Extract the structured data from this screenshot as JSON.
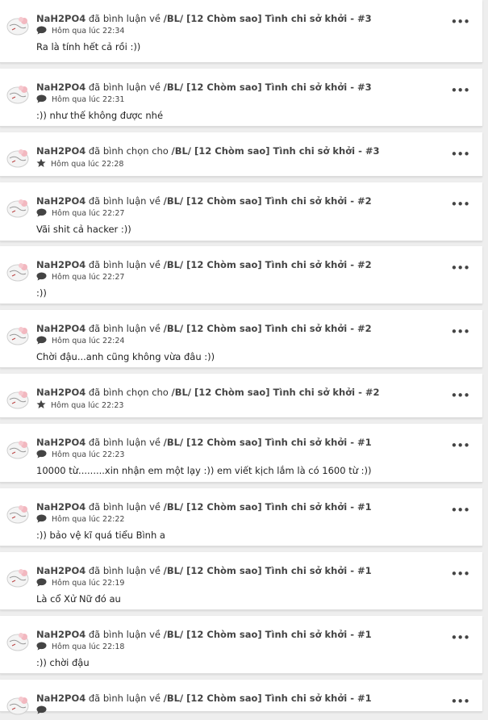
{
  "feed": {
    "user": "NaH2PO4",
    "items": [
      {
        "action": "đã bình luận về",
        "story": "/BL/ [12 Chòm sao] Tình chi sở khởi - #3",
        "meta_icon": "comment-icon",
        "time": "Hôm qua lúc 22:34",
        "content": "Ra là tính hết cả rồi :))"
      },
      {
        "action": "đã bình luận về",
        "story": "/BL/ [12 Chòm sao] Tình chi sở khởi - #3",
        "meta_icon": "comment-icon",
        "time": "Hôm qua lúc 22:31",
        "content": ":)) như thế không được nhé"
      },
      {
        "action": "đã bình chọn cho",
        "story": "/BL/ [12 Chòm sao] Tình chi sở khởi - #3",
        "meta_icon": "star-icon",
        "time": "Hôm qua lúc 22:28",
        "content": ""
      },
      {
        "action": "đã bình luận về",
        "story": "/BL/ [12 Chòm sao] Tình chi sở khởi - #2",
        "meta_icon": "comment-icon",
        "time": "Hôm qua lúc 22:27",
        "content": "Vãi shit cả hacker :))"
      },
      {
        "action": "đã bình luận về",
        "story": "/BL/ [12 Chòm sao] Tình chi sở khởi - #2",
        "meta_icon": "comment-icon",
        "time": "Hôm qua lúc 22:27",
        "content": ":))"
      },
      {
        "action": "đã bình luận về",
        "story": "/BL/ [12 Chòm sao] Tình chi sở khởi - #2",
        "meta_icon": "comment-icon",
        "time": "Hôm qua lúc 22:24",
        "content": "Chời đậu...anh cũng không vừa đâu :))"
      },
      {
        "action": "đã bình chọn cho",
        "story": "/BL/ [12 Chòm sao] Tình chi sở khởi - #2",
        "meta_icon": "star-icon",
        "time": "Hôm qua lúc 22:23",
        "content": ""
      },
      {
        "action": "đã bình luận về",
        "story": "/BL/ [12 Chòm sao] Tình chi sở khởi - #1",
        "meta_icon": "comment-icon",
        "time": "Hôm qua lúc 22:23",
        "content": "10000 từ.........xin nhận em một lạy :)) em viết kịch lắm là có 1600 từ :))"
      },
      {
        "action": "đã bình luận về",
        "story": "/BL/ [12 Chòm sao] Tình chi sở khởi - #1",
        "meta_icon": "comment-icon",
        "time": "Hôm qua lúc 22:22",
        "content": ":)) bảo vệ kĩ quá tiểu Bình a"
      },
      {
        "action": "đã bình luận về",
        "story": "/BL/ [12 Chòm sao] Tình chi sở khởi - #1",
        "meta_icon": "comment-icon",
        "time": "Hôm qua lúc 22:19",
        "content": "Là cổ Xử Nữ đó au"
      },
      {
        "action": "đã bình luận về",
        "story": "/BL/ [12 Chòm sao] Tình chi sở khởi - #1",
        "meta_icon": "comment-icon",
        "time": "Hôm qua lúc 22:18",
        "content": ":)) chời đậu"
      },
      {
        "action": "đã bình luận về",
        "story": "/BL/ [12 Chòm sao] Tình chi sở khởi - #1",
        "meta_icon": "comment-icon",
        "time": "",
        "content": ""
      }
    ],
    "more_label": "•••"
  }
}
